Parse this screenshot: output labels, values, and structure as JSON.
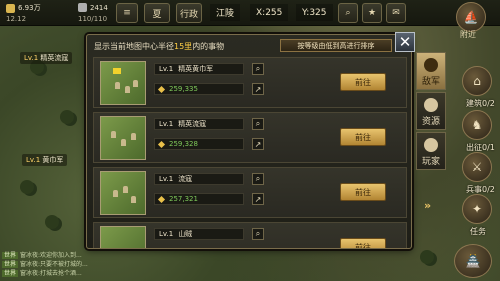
{
  "topbar": {
    "resources": [
      {
        "value": "6.93万",
        "sub": "12.12",
        "color": "#d9b650"
      },
      {
        "value": "2414",
        "sub": "110/110",
        "color": "#b0b0b0"
      }
    ],
    "view_btn": "夏",
    "location": "江陵",
    "coord_x": "X:255",
    "coord_y": "Y:325",
    "labels": [
      "夏",
      "行政"
    ],
    "nearby": "附近"
  },
  "map_labels": [
    {
      "level": "Lv.1",
      "name": "精英流寇"
    },
    {
      "level": "Lv.1",
      "name": "黄巾军"
    }
  ],
  "chat": {
    "lines": [
      {
        "channel": "世界",
        "text": "窗冰夜:欢迎你加入到..."
      },
      {
        "channel": "世界",
        "text": "窗冰夜:只要不被打城的..."
      },
      {
        "channel": "世界",
        "text": "窗冰夜:打城去抢个酒..."
      }
    ]
  },
  "sidebar_right": {
    "labels": [
      "建筑0/2",
      "出征0/1",
      "兵事0/2",
      "任务"
    ]
  },
  "dialog": {
    "title_prefix": "显示当前地图中心半径",
    "title_highlight": "15里",
    "title_suffix": "内的事物",
    "sort_label": "按等级由低到高进行排序",
    "go_label": "前往",
    "rows": [
      {
        "level": "Lv.1",
        "name": "精英黄巾军",
        "distance": "259,335"
      },
      {
        "level": "Lv.1",
        "name": "精英流寇",
        "distance": "259,328"
      },
      {
        "level": "Lv.1",
        "name": "流寇",
        "distance": "257,321"
      },
      {
        "level": "Lv.1",
        "name": "山贼",
        "distance": ""
      }
    ],
    "tabs": [
      {
        "label": "敌军",
        "active": true
      },
      {
        "label": "资源",
        "active": false
      },
      {
        "label": "玩家",
        "active": false
      }
    ]
  }
}
